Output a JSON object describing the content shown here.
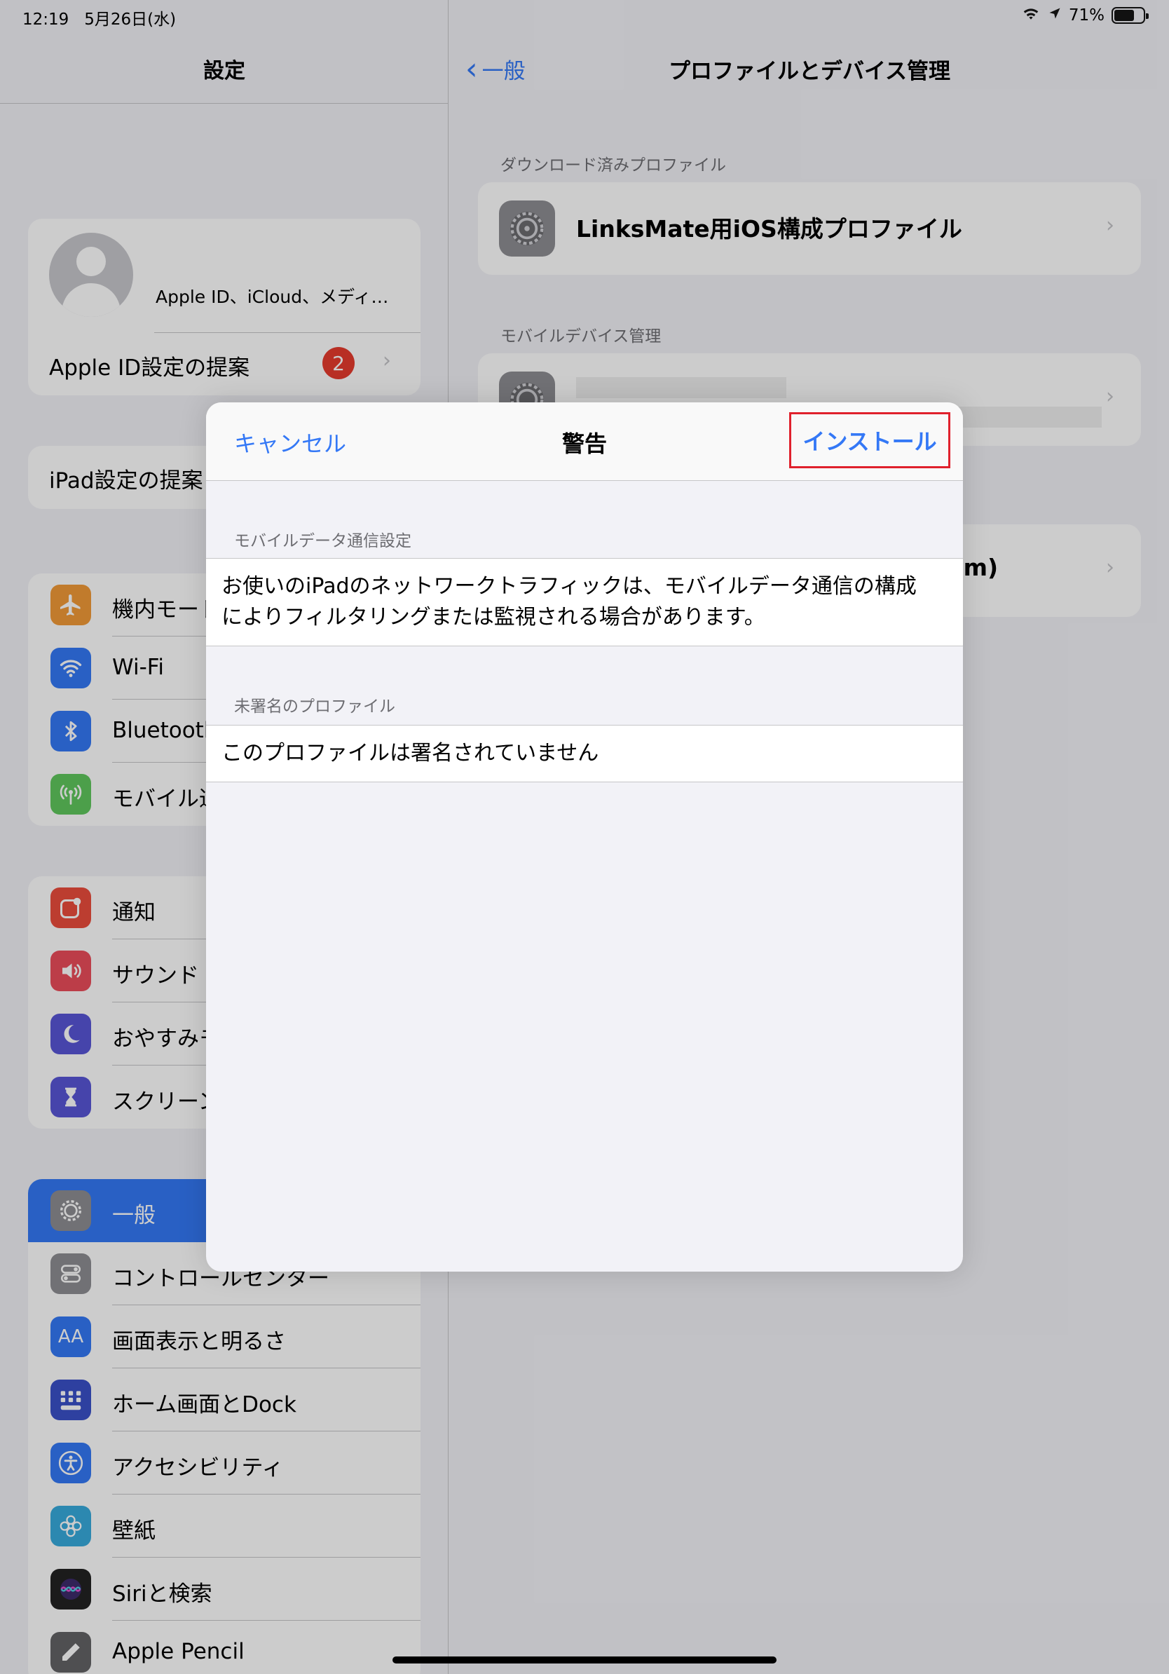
{
  "status": {
    "time": "12:19",
    "date": "5月26日(水)",
    "battery": "71%",
    "battery_fraction": 0.71
  },
  "sidebar": {
    "title": "設定",
    "account_subtitle": "Apple ID、iCloud、メディ…",
    "suggestion_label": "Apple ID設定の提案",
    "suggestion_badge": "2",
    "ipad_suggestion": "iPad設定の提案",
    "group1": [
      {
        "label": "機内モード",
        "icon": "airplane-icon",
        "color": "#f29a38"
      },
      {
        "label": "Wi-Fi",
        "icon": "wifi-icon",
        "color": "#3478f6"
      },
      {
        "label": "Bluetooth",
        "icon": "bluetooth-icon",
        "color": "#3478f6"
      },
      {
        "label": "モバイル通信",
        "icon": "antenna-icon",
        "color": "#5fc75d"
      }
    ],
    "group2": [
      {
        "label": "通知",
        "icon": "notification-icon",
        "color": "#eb4d3d"
      },
      {
        "label": "サウンド",
        "icon": "speaker-icon",
        "color": "#eb4d5b"
      },
      {
        "label": "おやすみモード",
        "icon": "moon-icon",
        "color": "#5856d6"
      },
      {
        "label": "スクリーンタイム",
        "icon": "hourglass-icon",
        "color": "#5856d6"
      }
    ],
    "group3": [
      {
        "label": "一般",
        "icon": "gear-icon",
        "color": "#8e8e93",
        "selected": true
      },
      {
        "label": "コントロールセンター",
        "icon": "toggles-icon",
        "color": "#8e8e93"
      },
      {
        "label": "画面表示と明るさ",
        "icon": "text-size-icon",
        "color": "#3478f6"
      },
      {
        "label": "ホーム画面とDock",
        "icon": "grid-icon",
        "color": "#3a50c8"
      },
      {
        "label": "アクセシビリティ",
        "icon": "accessibility-icon",
        "color": "#3478f6"
      },
      {
        "label": "壁紙",
        "icon": "flower-icon",
        "color": "#37aadc"
      },
      {
        "label": "Siriと検索",
        "icon": "siri-icon",
        "color": "#222222"
      },
      {
        "label": "Apple Pencil",
        "icon": "pencil-icon",
        "color": "#636366"
      }
    ]
  },
  "detail": {
    "back_label": "一般",
    "title": "プロファイルとデバイス管理",
    "downloaded_header": "ダウンロード済みプロファイル",
    "profile_name": "LinksMate用iOS構成プロファイル",
    "mdm_header": "モバイルデバイス管理",
    "partial_text": "om)"
  },
  "modal": {
    "cancel": "キャンセル",
    "title": "警告",
    "install": "インストール",
    "section1_header": "モバイルデータ通信設定",
    "section1_text": "お使いのiPadのネットワークトラフィックは、モバイルデータ通信の構成によりフィルタリングまたは監視される場合があります。",
    "section2_header": "未署名のプロファイル",
    "section2_text": "このプロファイルは署名されていません"
  }
}
